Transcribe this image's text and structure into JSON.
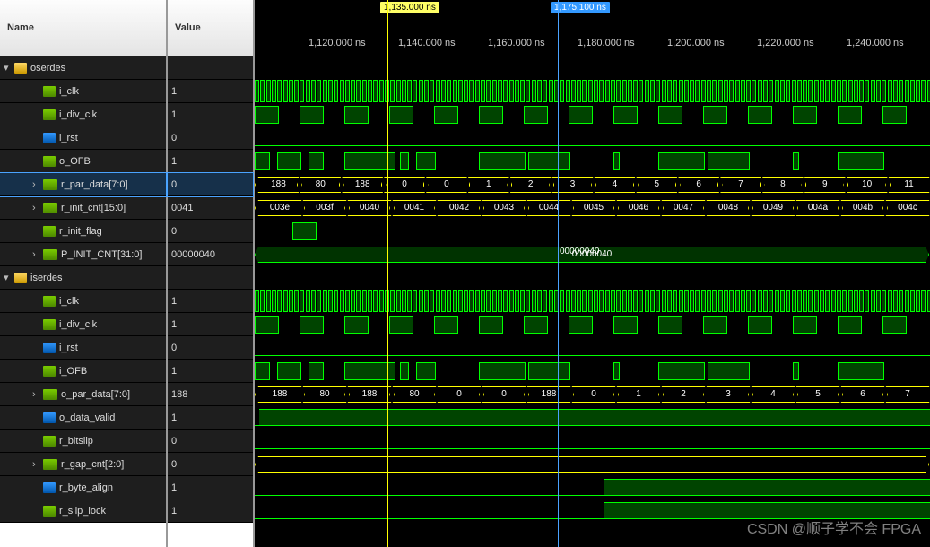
{
  "headers": {
    "name": "Name",
    "value": "Value"
  },
  "markers": {
    "yellow": "1,135.000 ns",
    "blue": "1,175.100 ns"
  },
  "ticks": [
    "1,120.000 ns",
    "1,140.000 ns",
    "1,160.000 ns",
    "1,180.000 ns",
    "1,200.000 ns",
    "1,220.000 ns",
    "1,240.000 ns"
  ],
  "groups": [
    {
      "name": "oserdes",
      "signals": [
        {
          "name": "i_clk",
          "value": "1",
          "type": "clk-fast"
        },
        {
          "name": "i_div_clk",
          "value": "1",
          "type": "clk-slow"
        },
        {
          "name": "i_rst",
          "value": "0",
          "type": "flat0"
        },
        {
          "name": "o_OFB",
          "value": "1",
          "type": "data"
        },
        {
          "name": "r_par_data[7:0]",
          "value": "0",
          "type": "bus",
          "selected": true,
          "data": [
            "188",
            "80",
            "188",
            "0",
            "0",
            "1",
            "2",
            "3",
            "4",
            "5",
            "6",
            "7",
            "8",
            "9",
            "10",
            "11"
          ]
        },
        {
          "name": "r_init_cnt[15:0]",
          "value": "0041",
          "type": "bus",
          "data": [
            "003e",
            "003f",
            "0040",
            "0041",
            "0042",
            "0043",
            "0044",
            "0045",
            "0046",
            "0047",
            "0048",
            "0049",
            "004a",
            "004b",
            "004c"
          ]
        },
        {
          "name": "r_init_flag",
          "value": "0",
          "type": "pulse1"
        },
        {
          "name": "P_INIT_CNT[31:0]",
          "value": "00000040",
          "type": "bus-const",
          "data": [
            "00000040"
          ]
        }
      ]
    },
    {
      "name": "iserdes",
      "signals": [
        {
          "name": "i_clk",
          "value": "1",
          "type": "clk-fast"
        },
        {
          "name": "i_div_clk",
          "value": "1",
          "type": "clk-slow"
        },
        {
          "name": "i_rst",
          "value": "0",
          "type": "flat0"
        },
        {
          "name": "i_OFB",
          "value": "1",
          "type": "data"
        },
        {
          "name": "o_par_data[7:0]",
          "value": "188",
          "type": "bus",
          "data": [
            "188",
            "80",
            "188",
            "80",
            "0",
            "0",
            "188",
            "0",
            "1",
            "2",
            "3",
            "4",
            "5",
            "6",
            "7"
          ]
        },
        {
          "name": "o_data_valid",
          "value": "1",
          "type": "flat1-late"
        },
        {
          "name": "r_bitslip",
          "value": "0",
          "type": "flat0"
        },
        {
          "name": "r_gap_cnt[2:0]",
          "value": "0",
          "type": "bus-empty"
        },
        {
          "name": "r_byte_align",
          "value": "1",
          "type": "flat1-late2"
        },
        {
          "name": "r_slip_lock",
          "value": "1",
          "type": "flat1-late2"
        }
      ]
    }
  ],
  "watermark": "CSDN @顺子学不会 FPGA"
}
